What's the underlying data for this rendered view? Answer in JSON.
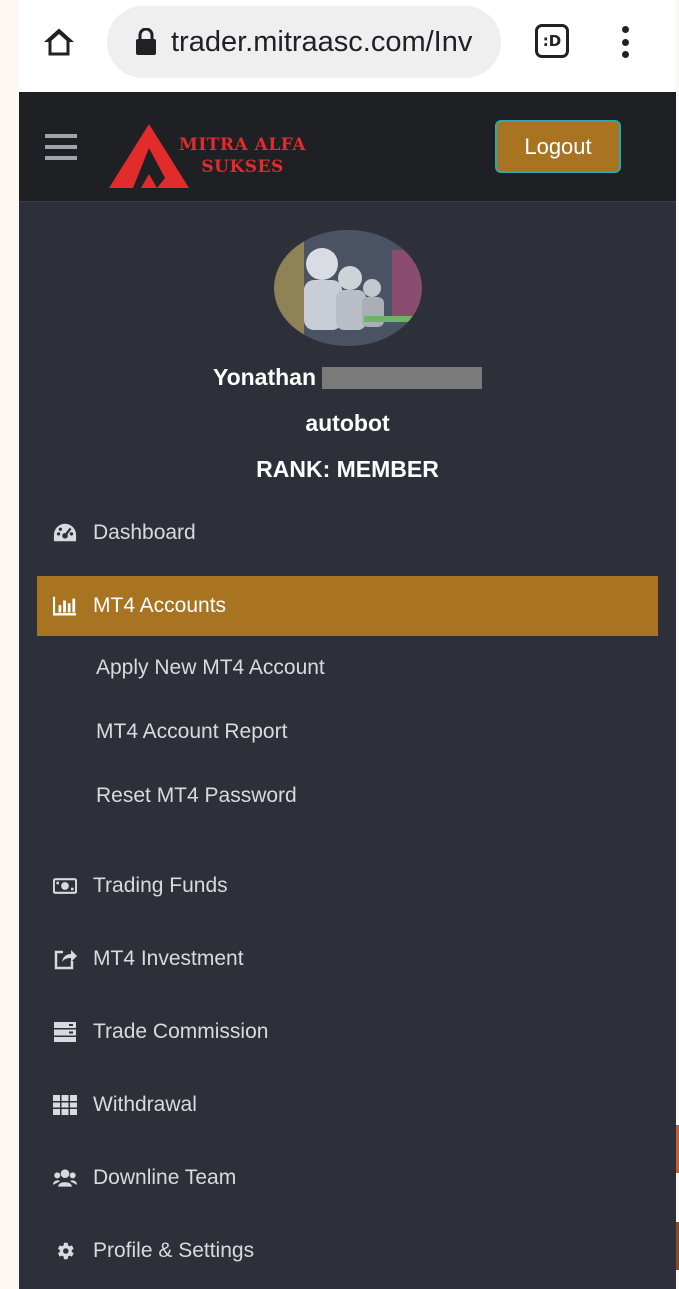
{
  "browser": {
    "url": "trader.mitraasc.com/Inv",
    "tab_switch_label": ":D",
    "icons": {
      "home": "home-icon",
      "lock": "lock-icon",
      "menu": "more-vert-icon"
    }
  },
  "header": {
    "logo_line1": "MITRA ALFA",
    "logo_line2": "SUKSES",
    "logout_label": "Logout",
    "colors": {
      "background": "#1f2024",
      "logo_red": "#e22b2b",
      "button": "#a87421",
      "button_border": "#29a9b5"
    }
  },
  "profile": {
    "name": "Yonathan",
    "username": "autobot",
    "rank": "RANK: MEMBER"
  },
  "nav": {
    "dashboard": "Dashboard",
    "mt4_accounts": "MT4 Accounts",
    "submenu": {
      "apply": "Apply New MT4 Account",
      "report": "MT4 Account Report",
      "reset": "Reset MT4 Password"
    },
    "trading_funds": "Trading Funds",
    "mt4_investment": "MT4 Investment",
    "trade_commission": "Trade Commission",
    "withdrawal": "Withdrawal",
    "downline_team": "Downline Team",
    "profile_settings": "Profile & Settings",
    "colors": {
      "sidebar": "#2e3039",
      "active": "#a87421",
      "text": "#d8dae0"
    }
  }
}
